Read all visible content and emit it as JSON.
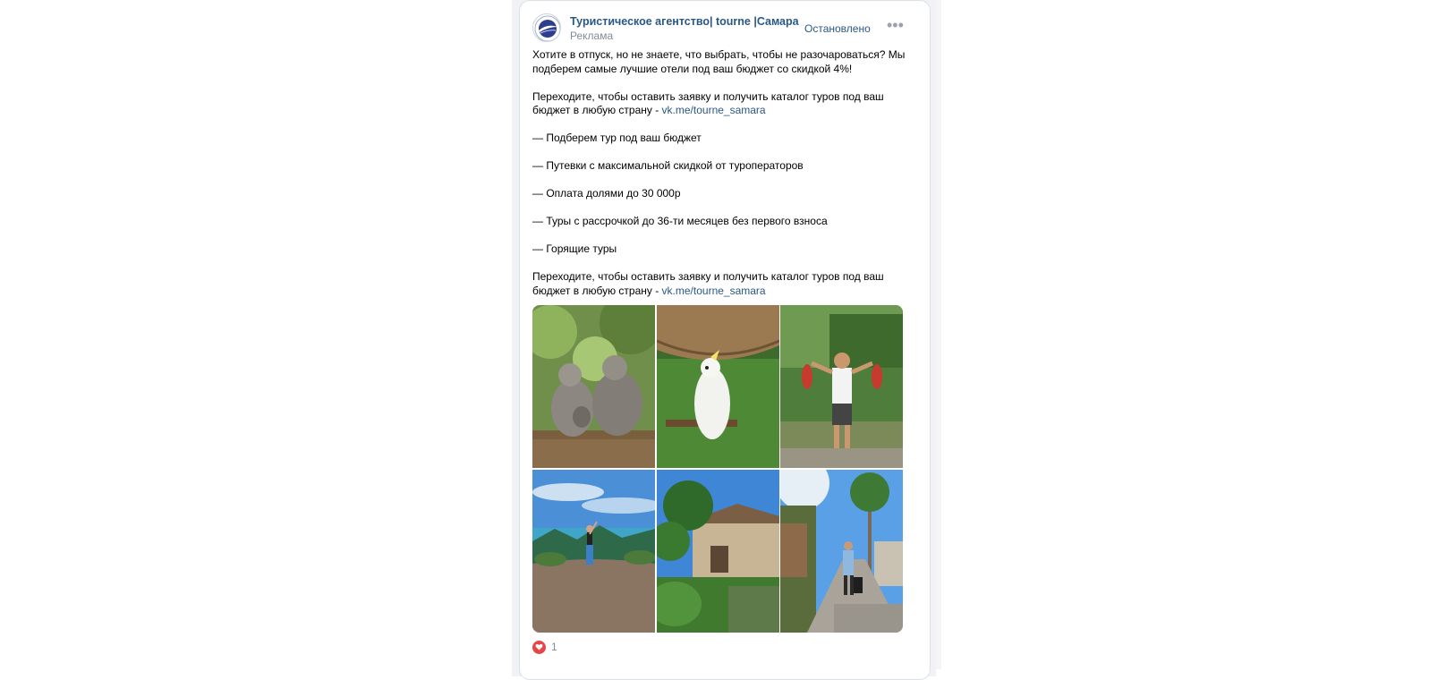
{
  "post": {
    "author": "Туристическое агентство| tourne |Самара",
    "ad_label": "Реклама",
    "status": "Остановлено",
    "more_icon": "more-horizontal-icon",
    "text": {
      "p1": "Хотите в отпуск, но не знаете, что выбрать, чтобы не разочароваться? Мы подберем самые лучшие отели под ваш бюджет со скидкой 4%!",
      "p2_text": "Переходите, чтобы оставить заявку и получить каталог туров под ваш бюджет в любую страну - ",
      "p2_link": "vk.me/tourne_samara",
      "b1": "— Подберем тур под ваш бюджет",
      "b2": "— Путевки с максимальной скидкой от туроператоров",
      "b3": "— Оплата долями до 30 000р",
      "b4": "— Туры с рассрочкой до 36-ти месяцев без первого взноса",
      "b5": "— Горящие туры",
      "p3_text": "Переходите, чтобы оставить заявку и получить каталог туров под ваш бюджет в любую страну - ",
      "p3_link": "vk.me/tourne_samara"
    },
    "photos": [
      {
        "subject": "monkeys on railing"
      },
      {
        "subject": "white cockatoo"
      },
      {
        "subject": "man with parrots"
      },
      {
        "subject": "woman on hilltop overlooking islands"
      },
      {
        "subject": "tropical garden villa"
      },
      {
        "subject": "street with traveler and suitcase"
      }
    ],
    "likes": {
      "icon": "heart-icon",
      "count": "1"
    }
  },
  "colors": {
    "link": "#2a5885",
    "muted": "#818c99",
    "like": "#e64646"
  }
}
